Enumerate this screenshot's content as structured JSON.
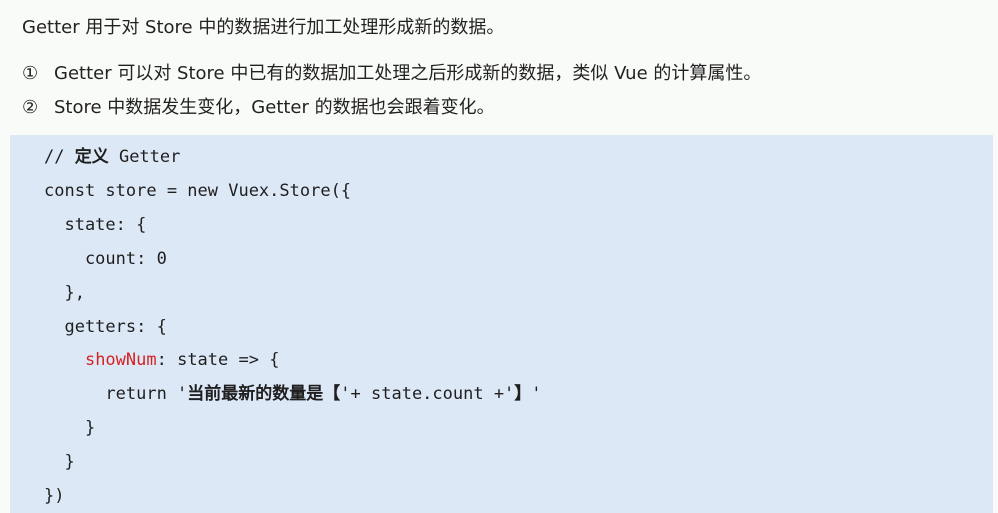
{
  "intro": "Getter 用于对 Store 中的数据进行加工处理形成新的数据。",
  "points": [
    {
      "marker": "①",
      "text": "Getter 可以对 Store 中已有的数据加工处理之后形成新的数据，类似 Vue 的计算属性。"
    },
    {
      "marker": "②",
      "text": "Store 中数据发生变化，Getter 的数据也会跟着变化。"
    }
  ],
  "code": {
    "l1_slashes": "// ",
    "l1_cn": "定义",
    "l1_rest": " Getter",
    "l2": "const store = new Vuex.Store({",
    "l3": "  state: {",
    "l4": "    count: 0",
    "l5": "  },",
    "l6": "  getters: {",
    "l7_indent": "    ",
    "l7_key": "showNum",
    "l7_rest": ": state => {",
    "l8_pre": "      return '",
    "l8_cn1": "当前最新的数量是【",
    "l8_mid": "'+ state.count +'",
    "l8_cn2": "】",
    "l8_end": "'",
    "l9": "    }",
    "l10": "  }",
    "l11": "})"
  },
  "colors": {
    "code_background": "#dde8f7",
    "page_background": "#f9fbf8",
    "highlight": "#d42323"
  }
}
